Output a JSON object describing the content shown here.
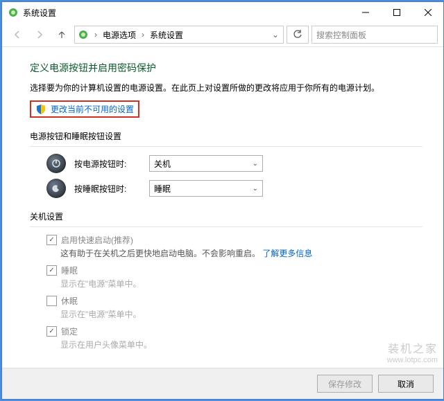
{
  "window": {
    "title": "系统设置"
  },
  "breadcrumb": {
    "a": "电源选项",
    "b": "系统设置"
  },
  "search": {
    "placeholder": "搜索控制面板"
  },
  "page": {
    "heading": "定义电源按钮并启用密码保护",
    "description": "选择要为你的计算机设置的电源设置。在此页上对设置所做的更改将应用于你所有的电源计划。",
    "change_unavailable": "更改当前不可用的设置"
  },
  "buttons_section": {
    "title": "电源按钮和睡眠按钮设置",
    "power_label": "按电源按钮时:",
    "power_value": "关机",
    "sleep_label": "按睡眠按钮时:",
    "sleep_value": "睡眠"
  },
  "shutdown_section": {
    "title": "关机设置",
    "fastboot_label": "启用快速启动(推荐)",
    "fastboot_desc": "这有助于在关机之后更快地启动电脑。不会影响重启。",
    "fastboot_link": "了解更多信息",
    "sleep_label": "睡眠",
    "sleep_desc": "显示在\"电源\"菜单中。",
    "hibernate_label": "休眠",
    "hibernate_desc": "显示在\"电源\"菜单中。",
    "lock_label": "锁定",
    "lock_desc": "显示在用户头像菜单中。"
  },
  "footer": {
    "save": "保存修改",
    "cancel": "取消"
  },
  "watermark": {
    "brand": "装机之家",
    "url": "www.lotpc.com"
  }
}
